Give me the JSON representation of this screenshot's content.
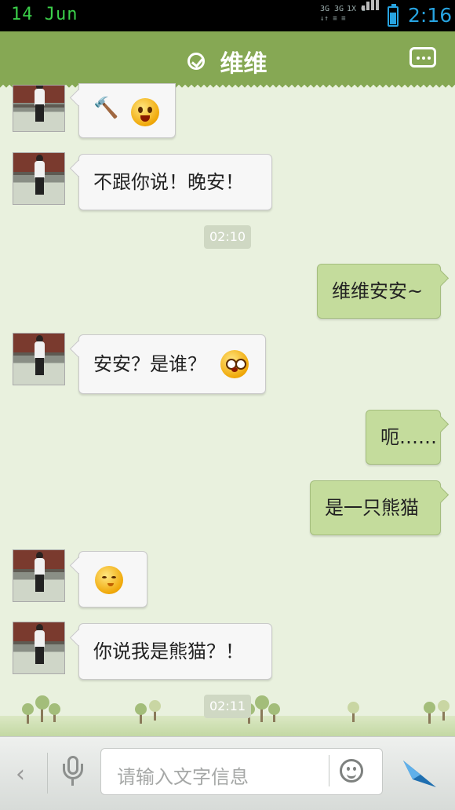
{
  "status_bar": {
    "date": "14 Jun",
    "network_labels": [
      "3G",
      "3G",
      "1X",
      "G"
    ],
    "time": "2:16",
    "battery_level": 0.75
  },
  "header": {
    "title": "维维",
    "verified_icon": "check-circle-icon",
    "menu_icon": "more-icon"
  },
  "messages": [
    {
      "from": "them",
      "text": "",
      "emojis": [
        "hammer-emoji",
        "angry-face-emoji"
      ]
    },
    {
      "from": "them",
      "text": "不跟你说！晚安！"
    },
    {
      "type": "timestamp",
      "text": "02:10"
    },
    {
      "from": "me",
      "text": "维维安安~"
    },
    {
      "from": "them",
      "text": "安安？是谁？",
      "emojis": [
        "dizzy-face-emoji"
      ]
    },
    {
      "from": "me",
      "text": "呃……"
    },
    {
      "from": "me",
      "text": "是一只熊猫"
    },
    {
      "from": "them",
      "text": "",
      "emojis": [
        "smug-face-emoji"
      ]
    },
    {
      "from": "them",
      "text": "你说我是熊猫？！"
    },
    {
      "type": "timestamp",
      "text": "02:11"
    }
  ],
  "composer": {
    "placeholder": "请输入文字信息",
    "icons": [
      "back-icon",
      "microphone-icon",
      "smiley-icon",
      "send-icon"
    ]
  },
  "colors": {
    "header": "#86a854",
    "incoming_bubble": "#f7f7f7",
    "outgoing_bubble": "#c4dc9c",
    "background": "#e9f1de",
    "clock": "#27a3e0"
  }
}
